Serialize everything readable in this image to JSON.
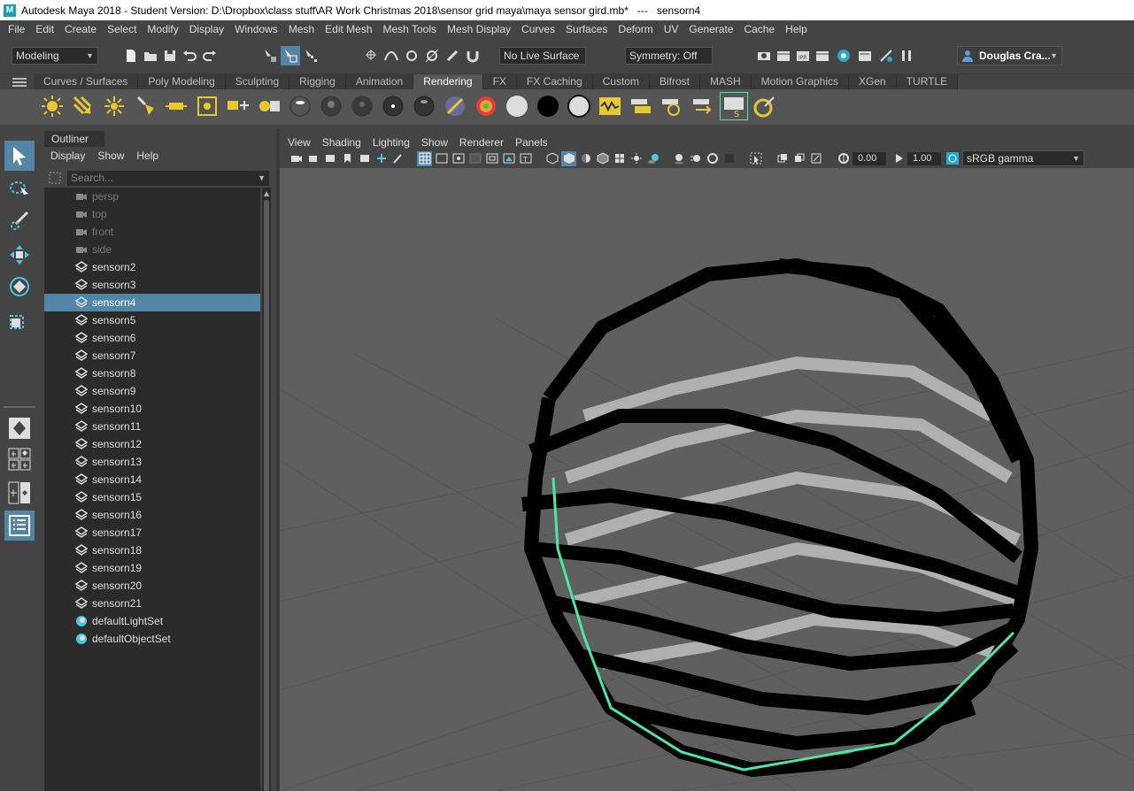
{
  "window": {
    "title": "Autodesk Maya 2018 - Student Version: D:\\Dropbox\\class stuff\\AR Work Christmas 2018\\sensor grid maya\\maya sensor gird.mb*   ---   sensorn4"
  },
  "menubar": [
    "File",
    "Edit",
    "Create",
    "Select",
    "Modify",
    "Display",
    "Windows",
    "Mesh",
    "Edit Mesh",
    "Mesh Tools",
    "Mesh Display",
    "Curves",
    "Surfaces",
    "Deform",
    "UV",
    "Generate",
    "Cache",
    "Help"
  ],
  "statusline": {
    "mode": "Modeling",
    "live_surface": "No Live Surface",
    "symmetry": "Symmetry: Off",
    "user": "Douglas Cra..."
  },
  "shelf": {
    "tabs": [
      "Curves / Surfaces",
      "Poly Modeling",
      "Sculpting",
      "Rigging",
      "Animation",
      "Rendering",
      "FX",
      "FX Caching",
      "Custom",
      "Bifrost",
      "MASH",
      "Motion Graphics",
      "XGen",
      "TURTLE"
    ],
    "active_tab": "Rendering"
  },
  "outliner": {
    "title": "Outliner",
    "menu": [
      "Display",
      "Show",
      "Help"
    ],
    "search_placeholder": "Search...",
    "items": [
      {
        "label": "persp",
        "type": "camera",
        "dim": true
      },
      {
        "label": "top",
        "type": "camera",
        "dim": true
      },
      {
        "label": "front",
        "type": "camera",
        "dim": true
      },
      {
        "label": "side",
        "type": "camera",
        "dim": true
      },
      {
        "label": "sensorn2",
        "type": "mesh"
      },
      {
        "label": "sensorn3",
        "type": "mesh"
      },
      {
        "label": "sensorn4",
        "type": "mesh",
        "selected": true
      },
      {
        "label": "sensorn5",
        "type": "mesh"
      },
      {
        "label": "sensorn6",
        "type": "mesh"
      },
      {
        "label": "sensorn7",
        "type": "mesh"
      },
      {
        "label": "sensorn8",
        "type": "mesh"
      },
      {
        "label": "sensorn9",
        "type": "mesh"
      },
      {
        "label": "sensorn10",
        "type": "mesh"
      },
      {
        "label": "sensorn11",
        "type": "mesh"
      },
      {
        "label": "sensorn12",
        "type": "mesh"
      },
      {
        "label": "sensorn13",
        "type": "mesh"
      },
      {
        "label": "sensorn14",
        "type": "mesh"
      },
      {
        "label": "sensorn15",
        "type": "mesh"
      },
      {
        "label": "sensorn16",
        "type": "mesh"
      },
      {
        "label": "sensorn17",
        "type": "mesh"
      },
      {
        "label": "sensorn18",
        "type": "mesh"
      },
      {
        "label": "sensorn19",
        "type": "mesh"
      },
      {
        "label": "sensorn20",
        "type": "mesh"
      },
      {
        "label": "sensorn21",
        "type": "mesh"
      },
      {
        "label": "defaultLightSet",
        "type": "set"
      },
      {
        "label": "defaultObjectSet",
        "type": "set"
      }
    ]
  },
  "viewport": {
    "menu": [
      "View",
      "Shading",
      "Lighting",
      "Show",
      "Renderer",
      "Panels"
    ],
    "exposure": "0.00",
    "gamma": "1.00",
    "color_space": "sRGB gamma"
  },
  "colors": {
    "selection": "#5285a6",
    "highlight_wire": "#48e8a8",
    "viewport_bg": "#5f5f5f"
  }
}
